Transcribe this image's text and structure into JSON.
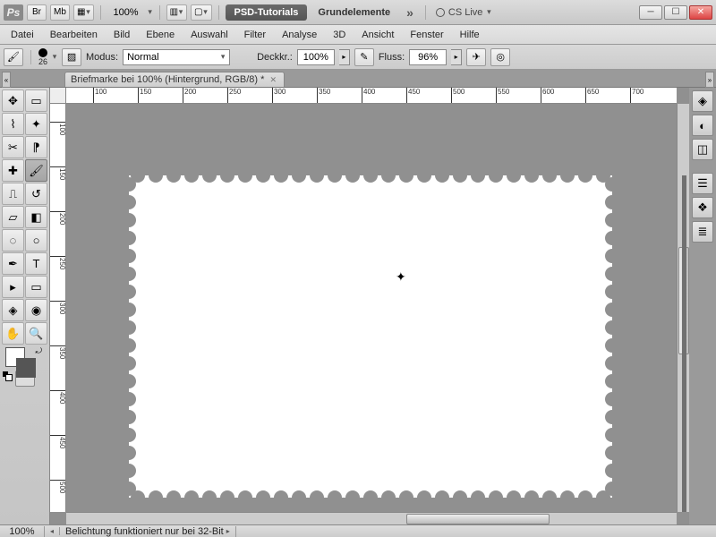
{
  "titlebar": {
    "app": "Ps",
    "launchers": [
      "Br",
      "Mb"
    ],
    "zoom": "100%",
    "workspace_tab1": "PSD-Tutorials",
    "workspace_tab2": "Grundelemente",
    "cs_live": "CS Live"
  },
  "menu": [
    "Datei",
    "Bearbeiten",
    "Bild",
    "Ebene",
    "Auswahl",
    "Filter",
    "Analyse",
    "3D",
    "Ansicht",
    "Fenster",
    "Hilfe"
  ],
  "options": {
    "brush_size": "26",
    "modus_label": "Modus:",
    "modus_value": "Normal",
    "deck_label": "Deckkr.:",
    "deck_value": "100%",
    "fluss_label": "Fluss:",
    "fluss_value": "96%"
  },
  "document": {
    "tab_title": "Briefmarke bei 100% (Hintergrund, RGB/8) *"
  },
  "ruler_h": [
    "100",
    "150",
    "200",
    "250",
    "300",
    "350",
    "400",
    "450",
    "500",
    "550",
    "600",
    "650",
    "700"
  ],
  "ruler_v": [
    "100",
    "150",
    "200",
    "250",
    "300",
    "350",
    "400",
    "450",
    "500"
  ],
  "status": {
    "zoom": "100%",
    "info": "Belichtung funktioniert nur bei 32-Bit"
  }
}
